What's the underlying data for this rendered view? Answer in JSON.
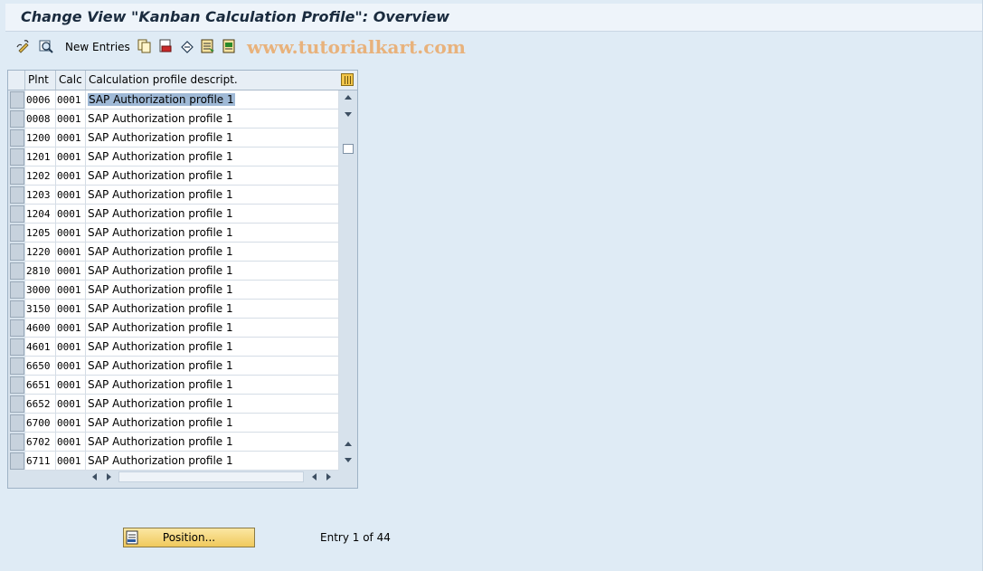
{
  "window": {
    "title": "Change View \"Kanban Calculation Profile\": Overview"
  },
  "toolbar": {
    "icons": [
      "display-change-icon",
      "details-icon",
      "copy-icon",
      "delete-icon",
      "undo-change-icon",
      "select-all-icon",
      "select-block-icon"
    ],
    "new_entries_label": "New Entries",
    "watermark": "www.tutorialkart.com"
  },
  "table": {
    "columns": [
      "Plnt",
      "Calc",
      "Calculation profile descript."
    ],
    "rows": [
      {
        "plnt": "0006",
        "calc": "0001",
        "desc": "SAP Authorization profile 1"
      },
      {
        "plnt": "0008",
        "calc": "0001",
        "desc": "SAP Authorization profile 1"
      },
      {
        "plnt": "1200",
        "calc": "0001",
        "desc": "SAP Authorization profile 1"
      },
      {
        "plnt": "1201",
        "calc": "0001",
        "desc": "SAP Authorization profile 1"
      },
      {
        "plnt": "1202",
        "calc": "0001",
        "desc": "SAP Authorization profile 1"
      },
      {
        "plnt": "1203",
        "calc": "0001",
        "desc": "SAP Authorization profile 1"
      },
      {
        "plnt": "1204",
        "calc": "0001",
        "desc": "SAP Authorization profile 1"
      },
      {
        "plnt": "1205",
        "calc": "0001",
        "desc": "SAP Authorization profile 1"
      },
      {
        "plnt": "1220",
        "calc": "0001",
        "desc": "SAP Authorization profile 1"
      },
      {
        "plnt": "2810",
        "calc": "0001",
        "desc": "SAP Authorization profile 1"
      },
      {
        "plnt": "3000",
        "calc": "0001",
        "desc": "SAP Authorization profile 1"
      },
      {
        "plnt": "3150",
        "calc": "0001",
        "desc": "SAP Authorization profile 1"
      },
      {
        "plnt": "4600",
        "calc": "0001",
        "desc": "SAP Authorization profile 1"
      },
      {
        "plnt": "4601",
        "calc": "0001",
        "desc": "SAP Authorization profile 1"
      },
      {
        "plnt": "6650",
        "calc": "0001",
        "desc": "SAP Authorization profile 1"
      },
      {
        "plnt": "6651",
        "calc": "0001",
        "desc": "SAP Authorization profile 1"
      },
      {
        "plnt": "6652",
        "calc": "0001",
        "desc": "SAP Authorization profile 1"
      },
      {
        "plnt": "6700",
        "calc": "0001",
        "desc": "SAP Authorization profile 1"
      },
      {
        "plnt": "6702",
        "calc": "0001",
        "desc": "SAP Authorization profile 1"
      },
      {
        "plnt": "6711",
        "calc": "0001",
        "desc": "SAP Authorization profile 1"
      }
    ],
    "highlighted_row": 0
  },
  "footer": {
    "position_button_label": "Position...",
    "entry_info": "Entry 1 of 44"
  },
  "colors": {
    "background": "#dfebf5",
    "title_bar": "#eef4fa",
    "button_yellow": "#f0c95c",
    "selection_highlight": "#9fb9d6"
  }
}
